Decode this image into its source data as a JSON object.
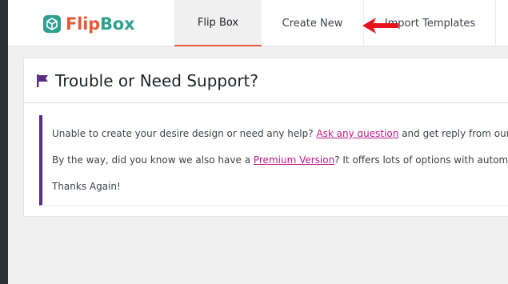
{
  "app": {
    "logo_part1": "Flip",
    "logo_part2": "Box"
  },
  "tabs": [
    {
      "label": "Flip Box",
      "active": true
    },
    {
      "label": "Create New",
      "active": false
    },
    {
      "label": "Import Templates",
      "active": false
    }
  ],
  "card": {
    "title": "Trouble or Need Support?"
  },
  "notice": {
    "line1_before": "Unable to create your desire design or need any help? ",
    "line1_link": "Ask any question",
    "line1_after": " and get reply from our expe",
    "line2_before": "By the way, did you know we also have a ",
    "line2_link": "Premium Version",
    "line2_after": "? It offers lots of options with automatic u",
    "line3": "Thanks Again!"
  },
  "colors": {
    "brand_flip": "#e45b3a",
    "brand_box": "#2ea18f",
    "notice_border": "#5b2c83",
    "link": "#c01a8a",
    "arrow": "#e8131b"
  },
  "icons": {
    "logo": "flipbox-logo-icon",
    "flag": "flag-icon",
    "annotation": "red-arrow-icon"
  }
}
